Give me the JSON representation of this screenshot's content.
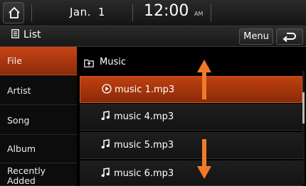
{
  "status": {
    "date_month": "Jan.",
    "date_day": "1",
    "time": "12:00",
    "ampm": "AM"
  },
  "header": {
    "title": "List",
    "menu_label": "Menu"
  },
  "sidebar": {
    "items": [
      {
        "label": "File"
      },
      {
        "label": "Artist"
      },
      {
        "label": "Song"
      },
      {
        "label": "Album"
      },
      {
        "label": "Recently Added",
        "line1": "Recently",
        "line2": "Added"
      }
    ]
  },
  "list": {
    "folder": "Music",
    "items": [
      {
        "label": "music 1.mp3",
        "state": "playing"
      },
      {
        "label": "music 4.mp3"
      },
      {
        "label": "music 5.mp3"
      },
      {
        "label": "music 6.mp3"
      }
    ]
  },
  "colors": {
    "accent": "#c84416",
    "arrow": "#f07a2a"
  },
  "icons": [
    "home-icon",
    "list-icon",
    "back-icon",
    "folder-up-icon",
    "play-icon",
    "music-note-icon",
    "arrow-up-icon",
    "arrow-down-icon"
  ]
}
